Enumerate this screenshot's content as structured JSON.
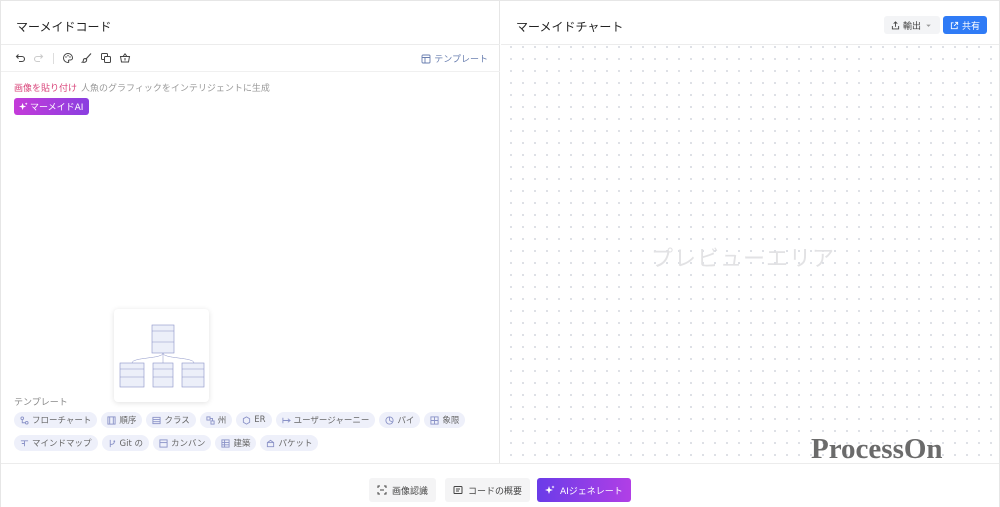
{
  "left_panel": {
    "title": "マーメイドコード",
    "toolbar": {
      "icons": [
        "undo-icon",
        "redo-icon",
        "palette-icon",
        "brush-icon",
        "copy-icon",
        "basket-icon"
      ],
      "template_link": "テンプレート"
    },
    "editor": {
      "paste_image": "画像を貼り付け",
      "hint": "人魚のグラフィックをインテリジェントに生成",
      "ai_chip": "マーメイドAI"
    },
    "templates": {
      "label": "テンプレート",
      "row1": [
        {
          "label": "フローチャート",
          "icon": "flowchart-icon"
        },
        {
          "label": "順序",
          "icon": "sequence-icon"
        },
        {
          "label": "クラス",
          "icon": "class-icon"
        },
        {
          "label": "州",
          "icon": "state-icon"
        },
        {
          "label": "ER",
          "icon": "er-icon"
        },
        {
          "label": "ユーザージャーニー",
          "icon": "journey-icon"
        },
        {
          "label": "パイ",
          "icon": "pie-icon"
        },
        {
          "label": "象限",
          "icon": "quadrant-icon"
        }
      ],
      "row2": [
        {
          "label": "マインドマップ",
          "icon": "mindmap-icon"
        },
        {
          "label": "Git の",
          "icon": "git-icon"
        },
        {
          "label": "カンバン",
          "icon": "kanban-icon"
        },
        {
          "label": "建築",
          "icon": "architecture-icon"
        },
        {
          "label": "パケット",
          "icon": "packet-icon"
        }
      ]
    }
  },
  "right_panel": {
    "title": "マーメイドチャート",
    "export_label": "輸出",
    "share_label": "共有",
    "preview_placeholder": "プレビューエリア",
    "watermark": "ProcessOn"
  },
  "bottom_bar": {
    "image_recognition": "画像認識",
    "code_overview": "コードの概要",
    "ai_generate": "AIジェネレート"
  },
  "colors": {
    "accent_pink": "#d9447a",
    "ai_gradient_start": "#c43bd9",
    "ai_gradient_end": "#8a3fe0",
    "share_blue": "#2f7bf6",
    "chip_bg": "#eef0fa"
  }
}
